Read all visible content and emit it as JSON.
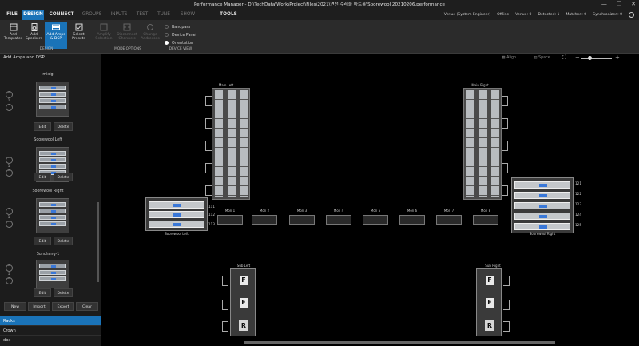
{
  "app": {
    "title": "Performance Manager - D:\\TechData\\Work\\Project\\Files\\2021\\연천 수레울 아트홀\\Soorewool 20210206.performance"
  },
  "window": {
    "minimize": "—",
    "restore": "❐",
    "close": "✕"
  },
  "menu": {
    "tabs": [
      "FILE",
      "DESIGN",
      "CONNECT",
      "GROUPS",
      "INPUTS",
      "TEST",
      "TUNE",
      "SHOW",
      "TOOLS"
    ],
    "active": "DESIGN"
  },
  "status": {
    "venue": "Venue (System Engineer)",
    "offline": "Offline",
    "venue_count": "Venue: 0",
    "detected": "Detected: 1",
    "matched": "Matched: 0",
    "synchronized": "Synchronized: 0"
  },
  "ribbon": {
    "buttons": [
      {
        "label": "Add Templates",
        "icon": "templates-icon"
      },
      {
        "label": "Add Speakers",
        "icon": "speaker-icon"
      },
      {
        "label": "Add Amps & DSP",
        "icon": "amp-icon"
      },
      {
        "label": "Select Presets",
        "icon": "preset-icon"
      },
      {
        "label": "Amplify Selection",
        "icon": "amplify-icon"
      },
      {
        "label": "Disconnect Channels",
        "icon": "disconnect-icon"
      },
      {
        "label": "Change Addresses",
        "icon": "change-address-icon"
      }
    ],
    "groups": {
      "design": "DESIGN",
      "mode_options": "MODE OPTIONS",
      "device_view": "DEVICE VIEW"
    },
    "device_view": [
      "Bandpass",
      "Device Panel",
      "Orientation"
    ],
    "device_view_selected": "Orientation"
  },
  "panel": {
    "title": "Add Amps and DSP",
    "racks": [
      {
        "name": "mixig",
        "count": "1"
      },
      {
        "name": "Soorewool Left",
        "count": "1"
      },
      {
        "name": "Soorewool Right",
        "count": "1"
      },
      {
        "name": "Sunchang-1",
        "count": "1"
      }
    ],
    "edit": "Edit",
    "delete": "Delete",
    "actions": [
      "New",
      "Import",
      "Export",
      "Clear"
    ],
    "categories": [
      "Racks",
      "Crown",
      "dbx"
    ],
    "active_category": "Racks"
  },
  "canvas_toolbar": {
    "align": "Align",
    "space": "Space",
    "zoom_minus": "−",
    "zoom_plus": "+"
  },
  "design": {
    "main_left": "Main Left",
    "main_right": "Main Right",
    "left_rack": {
      "name": "Soorewool Left",
      "channels": [
        "111",
        "112",
        "113"
      ]
    },
    "right_rack": {
      "name": "Soorewool Right",
      "channels": [
        "121",
        "122",
        "123",
        "124",
        "125"
      ]
    },
    "monitors": [
      "Mon 1",
      "Mon 2",
      "Mon 3",
      "Mon 4",
      "Mon 5",
      "Mon 6",
      "Mon 7",
      "Mon 8"
    ],
    "sub_left": "Sub Left",
    "sub_right": "Sub Right"
  }
}
